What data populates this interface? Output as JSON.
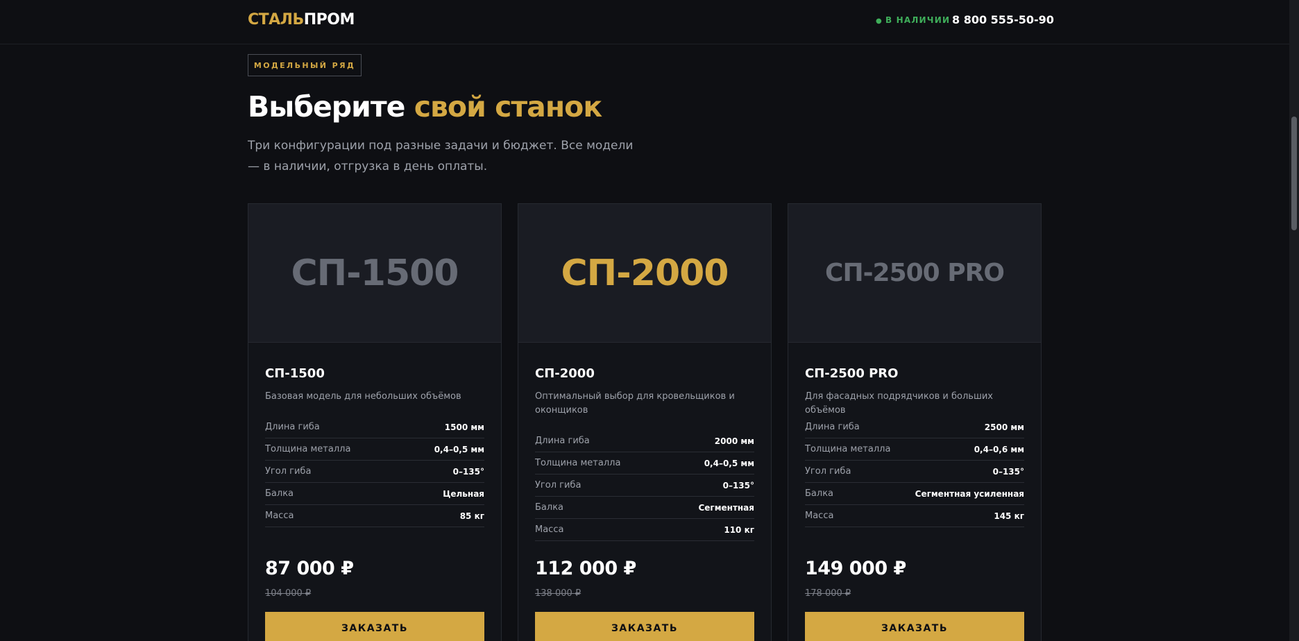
{
  "header": {
    "logo_part1": "СТАЛЬ",
    "logo_part2": "ПРОМ",
    "stock_label": "В НАЛИЧИИ",
    "phone": "8 800 555-50-90"
  },
  "section": {
    "badge": "МОДЕЛЬНЫЙ РЯД",
    "title_part1": "Выберите ",
    "title_highlight": "свой станок",
    "subtitle": "Три конфигурации под разные задачи и бюджет. Все модели — в наличии, отгрузка в день оплаты."
  },
  "colors": {
    "accent": "#d4a843",
    "background": "#0e0f13",
    "card_bg": "#121419",
    "muted_text": "#9ea2ab",
    "stock_green": "#3fae5a"
  },
  "products": [
    {
      "hero_label": "СП-1500",
      "name": "СП-1500",
      "description": "Базовая модель для небольших объёмов",
      "specs": [
        {
          "label": "Длина гиба",
          "value": "1500 мм"
        },
        {
          "label": "Толщина металла",
          "value": "0,4–0,5 мм"
        },
        {
          "label": "Угол гиба",
          "value": "0–135°"
        },
        {
          "label": "Балка",
          "value": "Цельная"
        },
        {
          "label": "Масса",
          "value": "85 кг"
        }
      ],
      "price": "87 000 ₽",
      "old_price": "104 000 ₽",
      "button_label": "ЗАКАЗАТЬ"
    },
    {
      "hero_label": "СП-2000",
      "name": "СП-2000",
      "description": "Оптимальный выбор для кровельщиков и оконщиков",
      "specs": [
        {
          "label": "Длина гиба",
          "value": "2000 мм"
        },
        {
          "label": "Толщина металла",
          "value": "0,4–0,5 мм"
        },
        {
          "label": "Угол гиба",
          "value": "0–135°"
        },
        {
          "label": "Балка",
          "value": "Сегментная"
        },
        {
          "label": "Масса",
          "value": "110 кг"
        }
      ],
      "price": "112 000 ₽",
      "old_price": "138 000 ₽",
      "button_label": "ЗАКАЗАТЬ"
    },
    {
      "hero_label": "СП-2500 PRO",
      "name": "СП-2500 PRO",
      "description": "Для фасадных подрядчиков и больших объёмов",
      "specs": [
        {
          "label": "Длина гиба",
          "value": "2500 мм"
        },
        {
          "label": "Толщина металла",
          "value": "0,4–0,6 мм"
        },
        {
          "label": "Угол гиба",
          "value": "0–135°"
        },
        {
          "label": "Балка",
          "value": "Сегментная усиленная"
        },
        {
          "label": "Масса",
          "value": "145 кг"
        }
      ],
      "price": "149 000 ₽",
      "old_price": "178 000 ₽",
      "button_label": "ЗАКАЗАТЬ"
    }
  ]
}
